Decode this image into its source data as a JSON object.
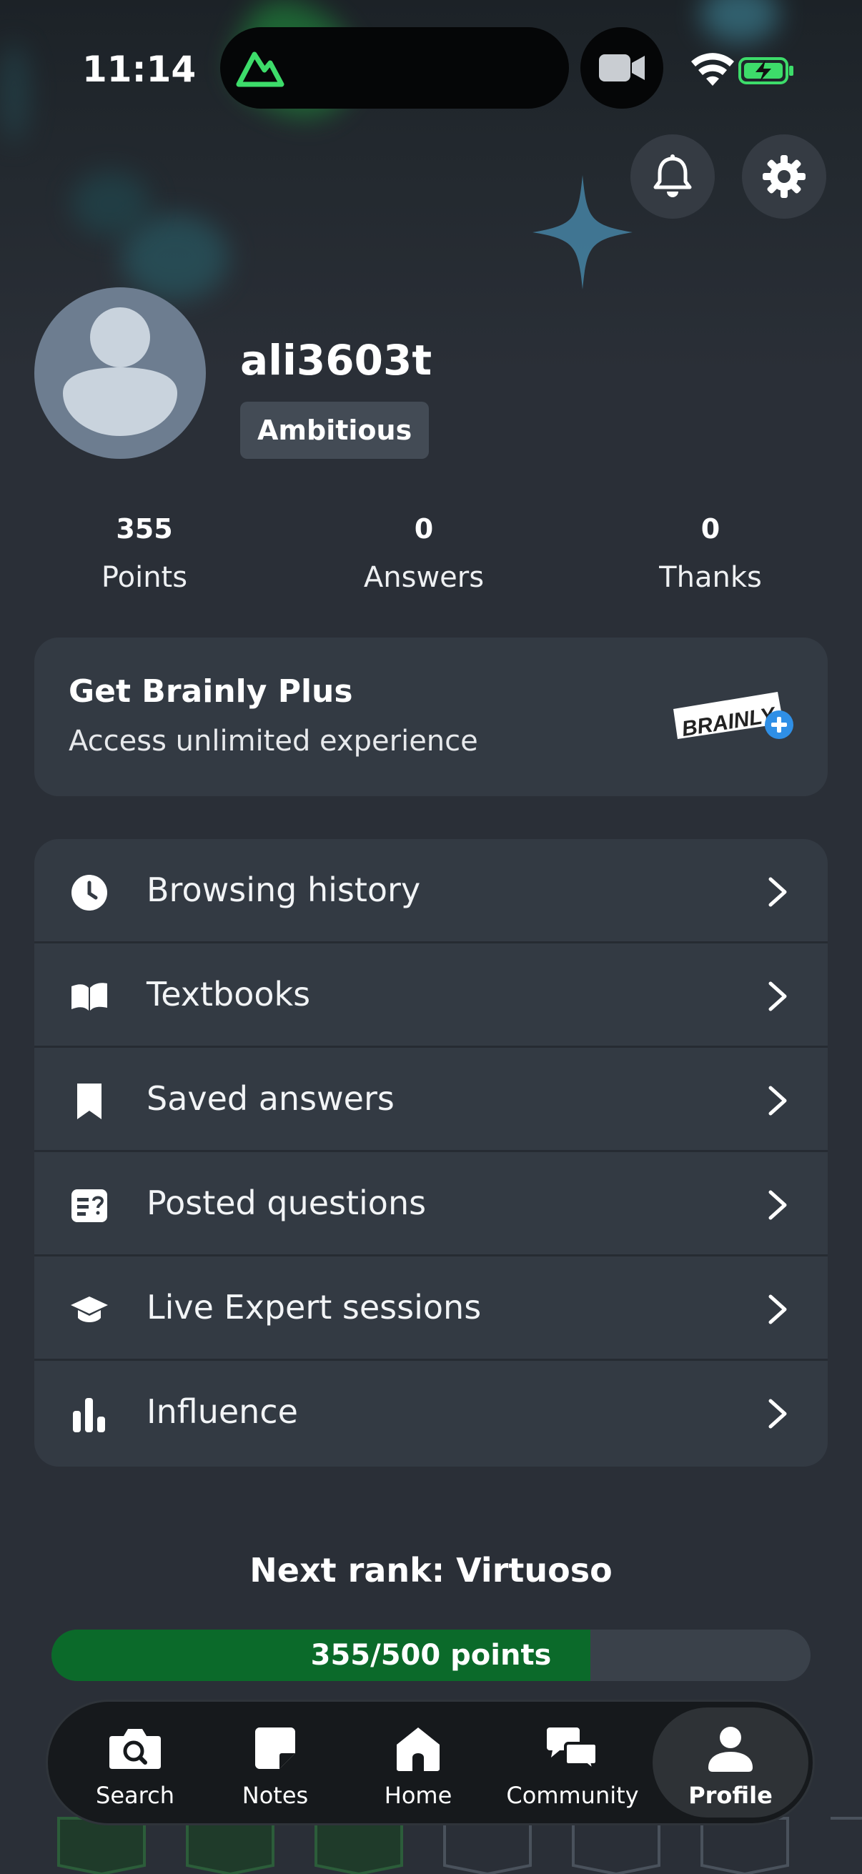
{
  "status_bar": {
    "time": "11:14"
  },
  "profile": {
    "username": "ali3603t",
    "rank": "Ambitious",
    "stats": [
      {
        "value": "355",
        "label": "Points"
      },
      {
        "value": "0",
        "label": "Answers"
      },
      {
        "value": "0",
        "label": "Thanks"
      }
    ]
  },
  "promo": {
    "title": "Get Brainly Plus",
    "subtitle": "Access unlimited experience",
    "logo_text": "BRAINLY"
  },
  "menu": [
    {
      "label": "Browsing history",
      "icon": "clock-icon"
    },
    {
      "label": "Textbooks",
      "icon": "book-icon"
    },
    {
      "label": "Saved answers",
      "icon": "bookmark-icon"
    },
    {
      "label": "Posted questions",
      "icon": "question-card-icon"
    },
    {
      "label": "Live Expert sessions",
      "icon": "graduation-cap-icon"
    },
    {
      "label": "Influence",
      "icon": "bar-chart-icon"
    }
  ],
  "rank_progress": {
    "next_rank_label": "Next rank: Virtuoso",
    "progress_text": "355/500 points",
    "fraction": 0.71
  },
  "tabs": [
    {
      "label": "Search",
      "icon": "camera-search-icon"
    },
    {
      "label": "Notes",
      "icon": "note-icon"
    },
    {
      "label": "Home",
      "icon": "home-icon"
    },
    {
      "label": "Community",
      "icon": "chat-bubbles-icon"
    },
    {
      "label": "Profile",
      "icon": "person-icon",
      "active": true
    }
  ],
  "colors": {
    "accent_green": "#0b6a2a",
    "background": "#2a2f37",
    "card": "#333a43"
  }
}
